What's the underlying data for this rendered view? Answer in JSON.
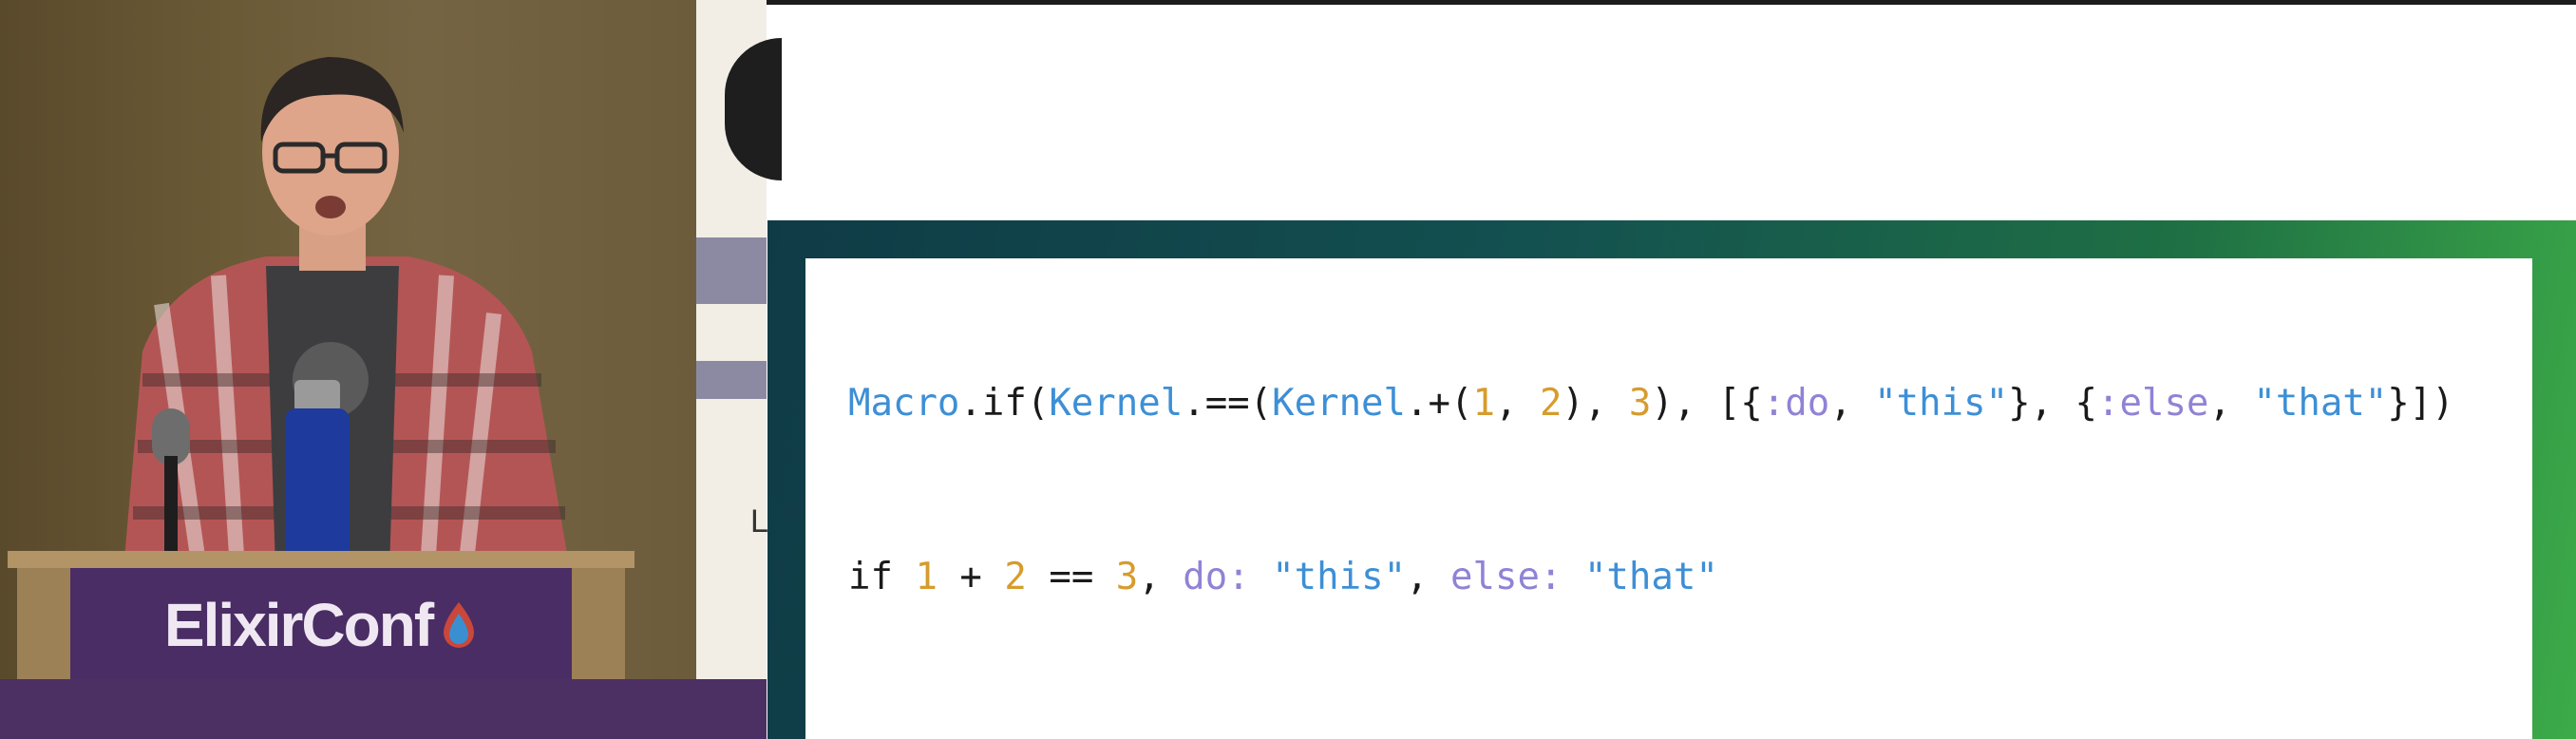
{
  "video": {
    "left_panel": {
      "lectern_sign": "ElixirConf",
      "banner_partial_letter": "L"
    },
    "slide": {
      "code_line_1": [
        {
          "text": "Macro",
          "type": "mod"
        },
        {
          "text": ".if(",
          "type": "kw"
        },
        {
          "text": "Kernel",
          "type": "mod"
        },
        {
          "text": ".==(",
          "type": "kw"
        },
        {
          "text": "Kernel",
          "type": "mod"
        },
        {
          "text": ".+(",
          "type": "kw"
        },
        {
          "text": "1",
          "type": "num"
        },
        {
          "text": ", ",
          "type": "kw"
        },
        {
          "text": "2",
          "type": "num"
        },
        {
          "text": "), ",
          "type": "kw"
        },
        {
          "text": "3",
          "type": "num"
        },
        {
          "text": "), [{",
          "type": "kw"
        },
        {
          "text": ":do",
          "type": "atom"
        },
        {
          "text": ", ",
          "type": "kw"
        },
        {
          "text": "\"this\"",
          "type": "str"
        },
        {
          "text": "}, {",
          "type": "kw"
        },
        {
          "text": ":else",
          "type": "atom"
        },
        {
          "text": ", ",
          "type": "kw"
        },
        {
          "text": "\"that\"",
          "type": "str"
        },
        {
          "text": "}])",
          "type": "kw"
        }
      ],
      "code_line_2": [
        {
          "text": "if ",
          "type": "kw"
        },
        {
          "text": "1",
          "type": "num"
        },
        {
          "text": " + ",
          "type": "kw"
        },
        {
          "text": "2",
          "type": "num"
        },
        {
          "text": " == ",
          "type": "kw"
        },
        {
          "text": "3",
          "type": "num"
        },
        {
          "text": ", ",
          "type": "kw"
        },
        {
          "text": "do:",
          "type": "atom"
        },
        {
          "text": " ",
          "type": "kw"
        },
        {
          "text": "\"this\"",
          "type": "str"
        },
        {
          "text": ", ",
          "type": "kw"
        },
        {
          "text": "else:",
          "type": "atom"
        },
        {
          "text": " ",
          "type": "kw"
        },
        {
          "text": "\"that\"",
          "type": "str"
        }
      ]
    },
    "colors": {
      "module": "#3d8fd6",
      "number": "#d69c2d",
      "atom": "#8f83d6",
      "string": "#3d8fd6",
      "lectern_sign_bg": "#4a2d64"
    }
  }
}
